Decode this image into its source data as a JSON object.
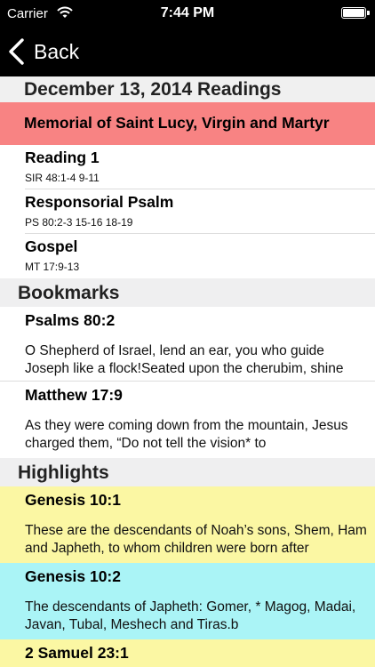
{
  "status_bar": {
    "carrier": "Carrier",
    "time": "7:44 PM"
  },
  "nav": {
    "back_label": "Back"
  },
  "readings": {
    "title": "December 13, 2014 Readings",
    "memorial": "Memorial of Saint Lucy, Virgin and Martyr",
    "memorial_color": "#f88383",
    "items": [
      {
        "title": "Reading 1",
        "citation": "SIR 48:1-4 9-11"
      },
      {
        "title": "Responsorial Psalm",
        "citation": "PS 80:2-3 15-16 18-19"
      },
      {
        "title": "Gospel",
        "citation": "MT 17:9-13"
      }
    ]
  },
  "bookmarks": {
    "title": "Bookmarks",
    "items": [
      {
        "ref": "Psalms 80:2",
        "text": "O Shepherd of Israel, lend an ear, you who guide Joseph like a flock!Seated upon the cherubim, shine"
      },
      {
        "ref": "Matthew 17:9",
        "text": "As they were coming down from the mountain, Jesus charged them, “Do not tell the vision* to"
      }
    ]
  },
  "highlights": {
    "title": "Highlights",
    "items": [
      {
        "ref": "Genesis 10:1",
        "text": "These are the descendants of Noah’s sons, Shem, Ham and Japheth, to whom children were born after",
        "color": "#fbf7a3"
      },
      {
        "ref": "Genesis 10:2",
        "text": "The descendants of Japheth: Gomer, * Magog, Madai, Javan, Tubal, Meshech and Tiras.b",
        "color": "#aaf4f6"
      },
      {
        "ref": "2 Samuel 23:1",
        "text": "",
        "color": "#fbf7a3"
      }
    ]
  }
}
